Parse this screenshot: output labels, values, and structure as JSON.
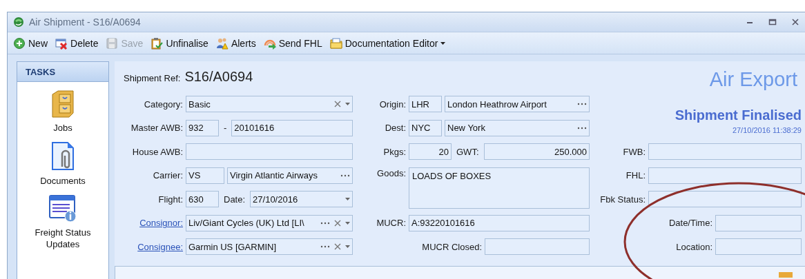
{
  "window": {
    "title": "Air Shipment - S16/A0694"
  },
  "toolbar": [
    {
      "label": "New",
      "kind": "new",
      "disabled": false
    },
    {
      "label": "Delete",
      "kind": "delete",
      "disabled": false
    },
    {
      "label": "Save",
      "kind": "save",
      "disabled": true
    },
    {
      "label": "Unfinalise",
      "kind": "clipboard",
      "disabled": false
    },
    {
      "label": "Alerts",
      "kind": "alerts",
      "disabled": false
    },
    {
      "label": "Send FHL",
      "kind": "send",
      "disabled": false
    },
    {
      "label": "Documentation Editor",
      "kind": "folder",
      "disabled": false,
      "dropdown": true
    }
  ],
  "sidebar": {
    "title": "TASKS",
    "items": [
      {
        "label": "Jobs",
        "kind": "cabinet"
      },
      {
        "label": "Documents",
        "kind": "document"
      },
      {
        "label": "Freight Status Updates",
        "kind": "status"
      }
    ]
  },
  "form": {
    "ref_label": "Shipment Ref:",
    "ref_value": "S16/A0694",
    "heading": "Air Export",
    "status": "Shipment Finalised",
    "status_time": "27/10/2016 11:38:29",
    "left": [
      {
        "label": "Category:",
        "link": false,
        "parts": [
          {
            "kind": "field",
            "value": "Basic",
            "clear": true,
            "dropdown": true
          }
        ]
      },
      {
        "label": "Master AWB:",
        "link": false,
        "parts": [
          {
            "kind": "code",
            "value": "932"
          },
          {
            "kind": "text",
            "value": "-"
          },
          {
            "kind": "field",
            "value": "20101616"
          }
        ]
      },
      {
        "label": "House AWB:",
        "link": false,
        "parts": [
          {
            "kind": "field"
          }
        ]
      },
      {
        "label": "Carrier:",
        "link": false,
        "parts": [
          {
            "kind": "code",
            "value": "VS"
          },
          {
            "kind": "field",
            "value": "Virgin Atlantic Airways",
            "lookup": true
          }
        ]
      },
      {
        "label": "Flight:",
        "link": false,
        "parts": [
          {
            "kind": "code",
            "value": "630"
          },
          {
            "kind": "text",
            "value": "Date:"
          },
          {
            "kind": "field",
            "value": "27/10/2016",
            "dropdown": true
          }
        ]
      },
      {
        "label": "Consignor:",
        "link": true,
        "parts": [
          {
            "kind": "field",
            "value": "Liv/Giant Cycles (UK) Ltd [LI\\",
            "lookup": true,
            "clear": true,
            "dropdown": true
          }
        ]
      },
      {
        "label": "Consignee:",
        "link": true,
        "parts": [
          {
            "kind": "field",
            "value": "Garmin US [GARMIN]",
            "lookup": true,
            "clear": true,
            "dropdown": true
          }
        ]
      }
    ],
    "middle": [
      {
        "label": "Origin:",
        "kind": "row",
        "parts": [
          {
            "kind": "code",
            "value": "LHR"
          },
          {
            "kind": "field",
            "value": "London Heathrow Airport",
            "lookup": true
          }
        ]
      },
      {
        "label": "Dest:",
        "kind": "row",
        "parts": [
          {
            "kind": "code",
            "value": "NYC"
          },
          {
            "kind": "field",
            "value": "New York",
            "lookup": true
          }
        ]
      },
      {
        "label": "Pkgs:",
        "kind": "row",
        "parts": [
          {
            "kind": "number",
            "value": "20"
          },
          {
            "kind": "text",
            "value": "GWT:"
          },
          {
            "kind": "numfield",
            "value": "250.000"
          }
        ]
      },
      {
        "label": "Goods:",
        "kind": "memo",
        "parts": [
          {
            "kind": "memo",
            "value": "LOADS OF BOXES"
          }
        ]
      },
      {
        "label": "MUCR:",
        "kind": "row",
        "parts": [
          {
            "kind": "field",
            "value": "A:93220101616"
          }
        ]
      },
      {
        "label": "MUCR Closed:",
        "kind": "inset",
        "parts": [
          {
            "kind": "field"
          }
        ]
      }
    ],
    "right": [
      {
        "label": "FWB:",
        "kind": "wide"
      },
      {
        "label": "FHL:",
        "kind": "wide"
      },
      {
        "label": "Fbk Status:",
        "kind": "wide"
      },
      {
        "label": "Date/Time:",
        "kind": "narrow"
      },
      {
        "label": "Location:",
        "kind": "narrow"
      }
    ]
  }
}
